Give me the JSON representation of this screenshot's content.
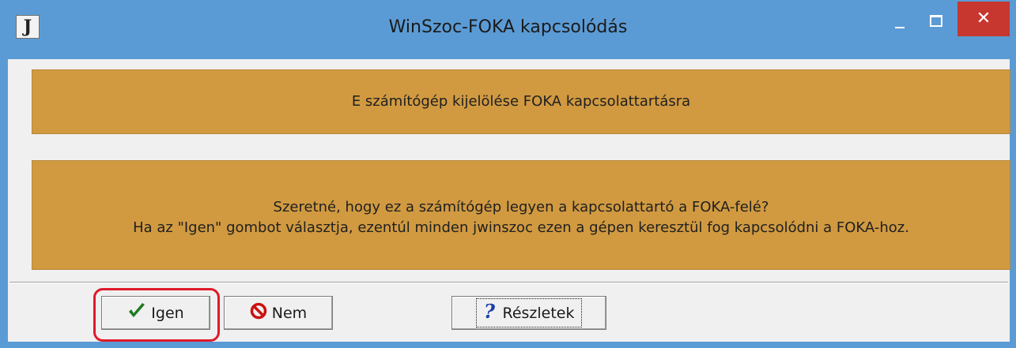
{
  "window": {
    "title": "WinSzoc-FOKA kapcsolódás",
    "app_icon_letter": "J",
    "close_glyph": "✕"
  },
  "panels": {
    "heading": "E számítógép kijelölése FOKA kapcsolattartásra",
    "question_line1": "Szeretné, hogy ez a számítógép legyen a kapcsolattartó a FOKA-felé?",
    "question_line2": "Ha az \"Igen\" gombot választja, ezentúl minden jwinszoc ezen a gépen keresztül fog kapcsolódni a FOKA-hoz."
  },
  "buttons": {
    "yes_label": "Igen",
    "no_label": "Nem",
    "details_label": "Részletek"
  },
  "icons": {
    "yes": "check-icon",
    "no": "prohibited-icon",
    "details": "question-icon"
  },
  "colors": {
    "titlebar": "#5b9bd5",
    "panel": "#d19a41",
    "close_button": "#c7372f",
    "highlight": "#e0192a"
  }
}
